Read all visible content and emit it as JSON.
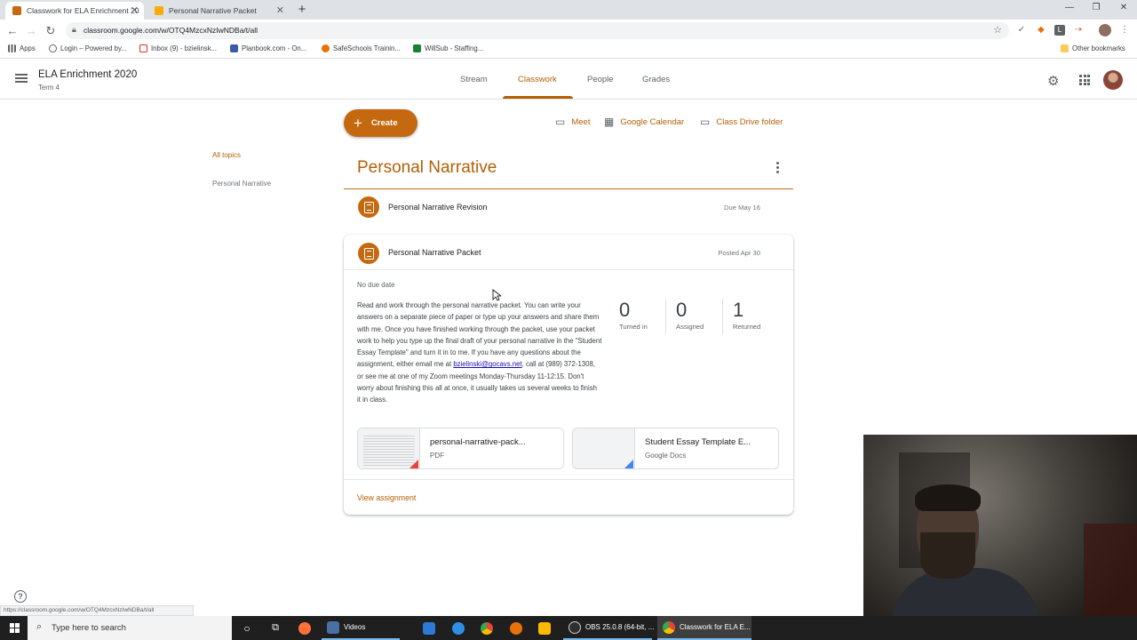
{
  "browser": {
    "tabs": [
      {
        "title": "Classwork for ELA Enrichment 20",
        "active": true,
        "favicon_color": "#f9ab00"
      },
      {
        "title": "Personal Narrative Packet",
        "active": false,
        "favicon_color": "#f9ab00"
      }
    ],
    "url": "classroom.google.com/w/OTQ4MzcxNzIwNDBa/t/all",
    "bookmarks": [
      {
        "label": "Apps",
        "icon": "apps-grid-icon",
        "color": "#5f6368"
      },
      {
        "label": "Login – Powered by...",
        "icon": "globe-icon",
        "color": "#5f6368"
      },
      {
        "label": "Inbox (9) - bzielinsk...",
        "icon": "gmail-icon",
        "color": "#d93025"
      },
      {
        "label": "Planbook.com - On...",
        "icon": "planbook-icon",
        "color": "#3b5ba5"
      },
      {
        "label": "SafeSchools Trainin...",
        "icon": "safeschools-icon",
        "color": "#e8710a"
      },
      {
        "label": "WillSub - Staffing...",
        "icon": "willsub-icon",
        "color": "#188038"
      }
    ],
    "other_bookmarks": "Other bookmarks",
    "status_url": "https://classroom.google.com/w/OTQ4MzcxNzIwNDBa/t/all"
  },
  "header": {
    "class_name": "ELA Enrichment 2020",
    "term": "Term 4",
    "tabs": [
      {
        "label": "Stream",
        "active": false
      },
      {
        "label": "Classwork",
        "active": true
      },
      {
        "label": "People",
        "active": false
      },
      {
        "label": "Grades",
        "active": false
      }
    ]
  },
  "toolbar": {
    "create_label": "Create",
    "meet_label": "Meet",
    "calendar_label": "Google Calendar",
    "drive_label": "Class Drive folder"
  },
  "sidebar": {
    "topics": [
      {
        "label": "All topics",
        "active": true
      },
      {
        "label": "Personal Narrative",
        "active": false
      }
    ]
  },
  "topic": {
    "title": "Personal Narrative",
    "assignments": [
      {
        "title": "Personal Narrative Revision",
        "meta": "Due May 16"
      },
      {
        "title": "Personal Narrative Packet",
        "meta": "Posted Apr 30"
      }
    ]
  },
  "expanded": {
    "due": "No due date",
    "description_before": "Read and work through the personal narrative packet. You can write your answers on a separate piece of paper or type up your answers and share them with me. Once you have finished working through the packet, use your packet work to help you type up the final draft of your personal narrative in the \"Student Essay Template\" and turn it in to me. If you have any questions about the assignment, either email me at ",
    "email": "bzielinski@gocavs.net",
    "description_after": ", call at (989) 372-1308, or see me at one of my Zoom meetings Monday-Thursday 11-12:15. Don't worry about finishing this all at once, it usually takes us several weeks to finish it in class.",
    "stats": [
      {
        "value": "0",
        "label": "Turned in"
      },
      {
        "value": "0",
        "label": "Assigned"
      },
      {
        "value": "1",
        "label": "Returned"
      }
    ],
    "attachments": [
      {
        "name": "personal-narrative-pack...",
        "type": "PDF",
        "accent": "#ea4335"
      },
      {
        "name": "Student Essay Template E...",
        "type": "Google Docs",
        "accent": "#4285f4"
      }
    ],
    "view_label": "View assignment"
  },
  "taskbar": {
    "search_placeholder": "Type here to search",
    "items": [
      {
        "label": "Videos",
        "icon": "videos-folder-icon"
      },
      {
        "label": "OBS 25.0.8 (64-bit, ...",
        "icon": "obs-icon"
      },
      {
        "label": "Classwork for ELA E...",
        "icon": "chrome-icon"
      }
    ]
  },
  "colors": {
    "accent": "#b45f06",
    "accent_button": "#c56911"
  }
}
